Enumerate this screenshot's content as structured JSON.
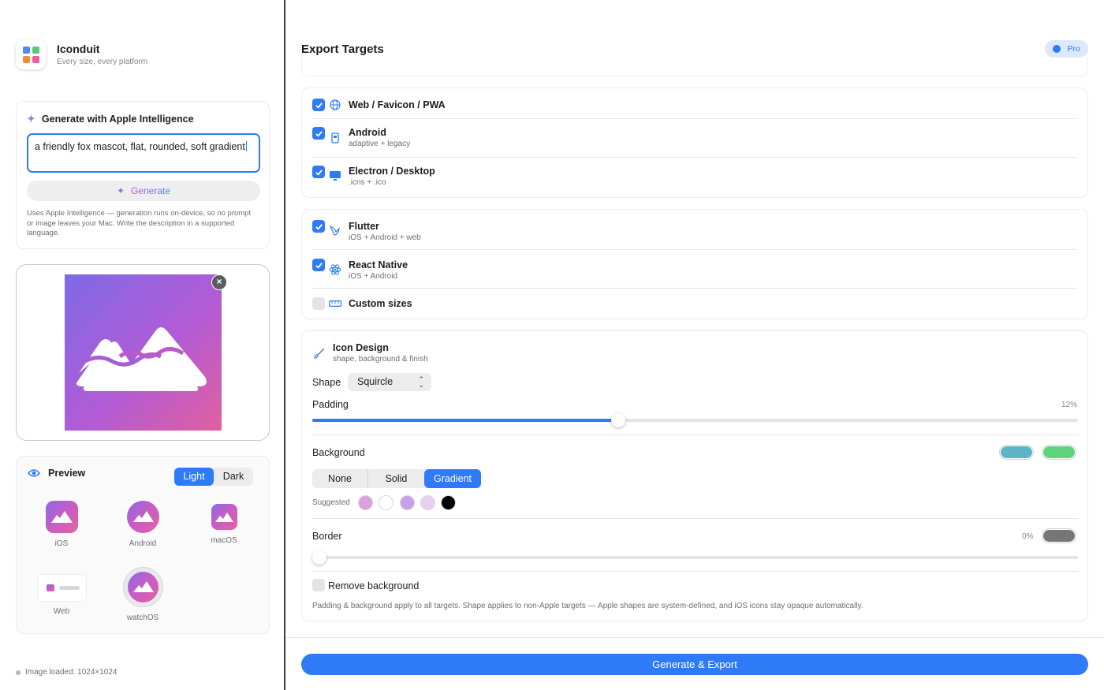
{
  "app": {
    "title": "Iconduit",
    "subtitle": "Every size, every platform"
  },
  "generate": {
    "title": "Generate with Apple Intelligence",
    "prompt_value": "a friendly fox mascot, flat, rounded, soft gradient",
    "button_label": "Generate",
    "note": "Uses Apple Intelligence — generation runs on-device, so no prompt or image leaves your Mac. Write the description in a supported language."
  },
  "preview": {
    "title": "Preview",
    "modes": [
      "Light",
      "Dark"
    ],
    "selected_mode": "Light",
    "platforms": [
      "iOS",
      "Android",
      "macOS",
      "Web",
      "watchOS"
    ]
  },
  "status": {
    "text": "Image loaded: 1024×1024"
  },
  "main": {
    "title": "Export Targets",
    "badge": "Pro"
  },
  "targets_group1": [
    {
      "name": "Web / Favicon / PWA",
      "sub": "",
      "checked": true,
      "icon": "globe-icon"
    },
    {
      "name": "Android",
      "sub": "adaptive + legacy",
      "checked": true,
      "icon": "phone-icon"
    },
    {
      "name": "Electron / Desktop",
      "sub": ".icns + .ico",
      "checked": true,
      "icon": "monitor-icon"
    }
  ],
  "targets_group2": [
    {
      "name": "Flutter",
      "sub": "iOS + Android + web",
      "checked": true,
      "icon": "bird-icon"
    },
    {
      "name": "React Native",
      "sub": "iOS + Android",
      "checked": true,
      "icon": "atom-icon"
    },
    {
      "name": "Custom sizes",
      "sub": "",
      "checked": false,
      "icon": "ruler-icon"
    }
  ],
  "design": {
    "title": "Icon Design",
    "subtitle": "shape, background & finish",
    "shape_label": "Shape",
    "shape_value": "Squircle",
    "padding_label": "Padding",
    "padding_value": "12%",
    "padding_fraction": 0.4,
    "background_label": "Background",
    "background_options": [
      "None",
      "Solid",
      "Gradient"
    ],
    "background_selected": "Gradient",
    "gradient_colors": [
      "#5bb5c6",
      "#5fd37c"
    ],
    "suggested_label": "Suggested",
    "suggested_colors": [
      "#dca0dd",
      "#ffffff",
      "#c5a2e8",
      "#e9cfee",
      "#000000"
    ],
    "border_label": "Border",
    "border_value": "0%",
    "border_fraction": 0.0,
    "border_color": "#767676",
    "remove_bg_label": "Remove background",
    "remove_bg_checked": false,
    "footnote": "Padding & background apply to all targets. Shape applies to non-Apple targets — Apple shapes are system-defined, and iOS icons stay opaque automatically."
  },
  "export": {
    "button_label": "Generate & Export"
  }
}
